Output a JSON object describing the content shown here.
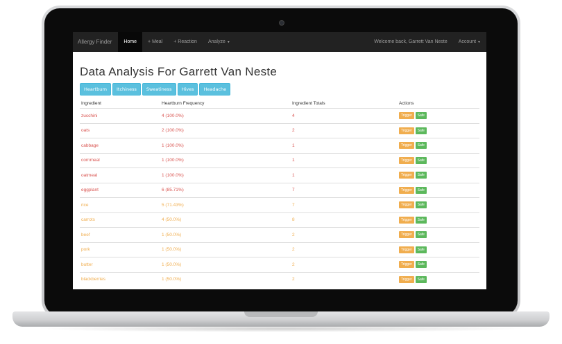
{
  "navbar": {
    "brand": "Allergy Finder",
    "items": [
      {
        "label": "Home",
        "active": true
      },
      {
        "label": "+ Meal",
        "active": false
      },
      {
        "label": "+ Reaction",
        "active": false
      },
      {
        "label": "Analyze",
        "active": false
      }
    ],
    "welcome": "Welcome back, Garrett Van Neste",
    "account": "Account"
  },
  "page": {
    "title": "Data Analysis For Garrett Van Neste",
    "filters": [
      "Heartburn",
      "Itchiness",
      "Sweatiness",
      "Hives",
      "Headache"
    ]
  },
  "table": {
    "headers": [
      "Ingredient",
      "Heartburn Frequency",
      "Ingredient Totals",
      "Actions"
    ],
    "trigger_label": "Trigger",
    "safe_label": "Safe",
    "rows": [
      {
        "ingredient": "zucchini",
        "frequency": "4 (100.0%)",
        "total": "4",
        "level": "danger"
      },
      {
        "ingredient": "oats",
        "frequency": "2 (100.0%)",
        "total": "2",
        "level": "danger"
      },
      {
        "ingredient": "cabbage",
        "frequency": "1 (100.0%)",
        "total": "1",
        "level": "danger"
      },
      {
        "ingredient": "cornmeal",
        "frequency": "1 (100.0%)",
        "total": "1",
        "level": "danger"
      },
      {
        "ingredient": "oatmeal",
        "frequency": "1 (100.0%)",
        "total": "1",
        "level": "danger"
      },
      {
        "ingredient": "eggplant",
        "frequency": "6 (85.71%)",
        "total": "7",
        "level": "danger"
      },
      {
        "ingredient": "rice",
        "frequency": "5 (71.43%)",
        "total": "7",
        "level": "warn"
      },
      {
        "ingredient": "carrots",
        "frequency": "4 (50.0%)",
        "total": "8",
        "level": "warn"
      },
      {
        "ingredient": "beef",
        "frequency": "1 (50.0%)",
        "total": "2",
        "level": "warn"
      },
      {
        "ingredient": "pork",
        "frequency": "1 (50.0%)",
        "total": "2",
        "level": "warn"
      },
      {
        "ingredient": "butter",
        "frequency": "1 (50.0%)",
        "total": "2",
        "level": "warn"
      },
      {
        "ingredient": "blackberries",
        "frequency": "1 (50.0%)",
        "total": "2",
        "level": "warn"
      }
    ]
  },
  "colors": {
    "navbar_bg": "#222222",
    "filter_button": "#5bc0de",
    "danger_text": "#d9534f",
    "warning_text": "#f0ad4e",
    "trigger_button": "#f0ad4e",
    "safe_button": "#5cb85c"
  }
}
